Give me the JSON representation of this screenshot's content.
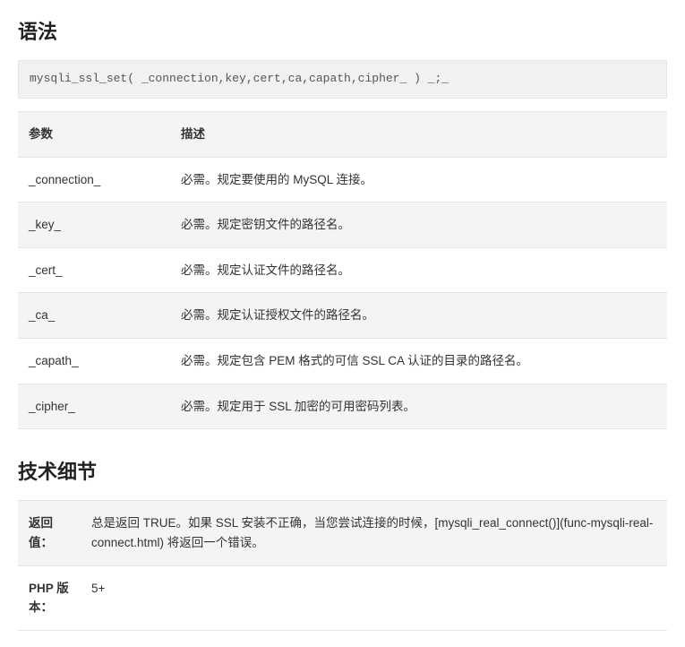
{
  "syntax": {
    "heading": "语法",
    "code": "mysqli_ssl_set( _connection,key,cert,ca,capath,cipher_ ) _;_"
  },
  "params_table": {
    "header_param": "参数",
    "header_desc": "描述",
    "rows": [
      {
        "param": "_connection_",
        "desc": "必需。规定要使用的 MySQL 连接。"
      },
      {
        "param": "_key_",
        "desc": "必需。规定密钥文件的路径名。"
      },
      {
        "param": "_cert_",
        "desc": "必需。规定认证文件的路径名。"
      },
      {
        "param": "_ca_",
        "desc": "必需。规定认证授权文件的路径名。"
      },
      {
        "param": "_capath_",
        "desc": "必需。规定包含 PEM 格式的可信 SSL CA 认证的目录的路径名。"
      },
      {
        "param": "_cipher_",
        "desc": "必需。规定用于 SSL 加密的可用密码列表。"
      }
    ]
  },
  "details": {
    "heading": "技术细节",
    "rows": [
      {
        "label": "返回值：",
        "value": "总是返回 TRUE。如果 SSL 安装不正确，当您尝试连接的时候，[mysqli_real_connect()](func-mysqli-real- connect.html) 将返回一个错误。"
      },
      {
        "label": "PHP 版本：",
        "value": "5+"
      }
    ]
  }
}
